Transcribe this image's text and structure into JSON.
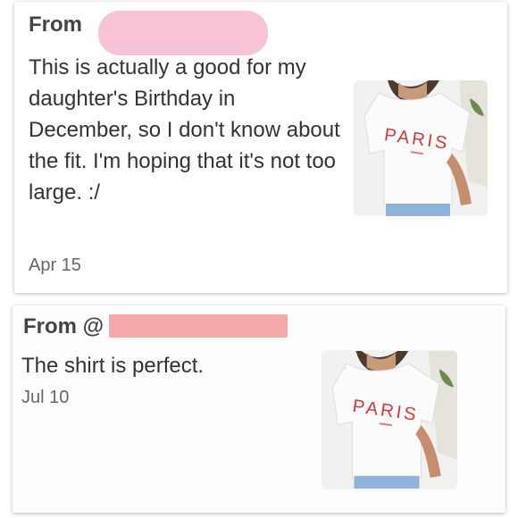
{
  "reviews": [
    {
      "from_label": "From",
      "text": "This is actually a good for my daughter's Birthday in December, so I don't know about the fit. I'm hoping that it's not too large. :/",
      "date": "Apr 15",
      "redaction_color": "#f7c3d6",
      "photo": {
        "icon": "tshirt-photo",
        "shirt_text": "PARIS"
      }
    },
    {
      "from_label": "From @",
      "text": "The shirt is perfect.",
      "date": "Jul 10",
      "redaction_color": "#f5a8a8",
      "photo": {
        "icon": "tshirt-photo",
        "shirt_text": "PARIS"
      }
    }
  ],
  "colors": {
    "text": "#333333",
    "muted": "#666666",
    "shirt_print": "#d23a3a"
  }
}
